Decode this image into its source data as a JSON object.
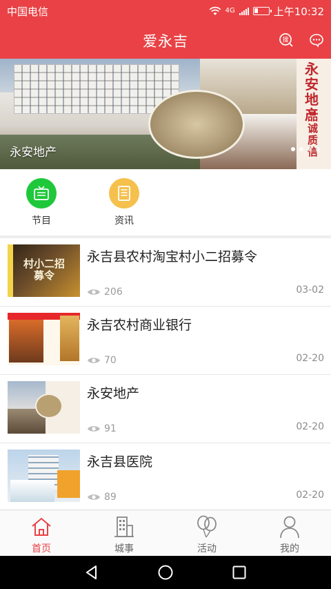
{
  "status_bar": {
    "carrier": "中国电信",
    "network": "4G",
    "time": "上午10:32"
  },
  "header": {
    "title": "爱永吉",
    "search_icon": "search-icon",
    "message_icon": "message-icon"
  },
  "banner": {
    "caption": "永安地产",
    "sign_text_1": "永安地产",
    "sign_text_2": "品诚质信",
    "dots": 4,
    "active_dot": 0
  },
  "quick_nav": [
    {
      "label": "节目",
      "icon": "tv-icon",
      "color": "#1fc83a"
    },
    {
      "label": "资讯",
      "icon": "news-icon",
      "color": "#f5c04c"
    }
  ],
  "news": [
    {
      "title": "永吉县农村淘宝村小二招募令",
      "views": "206",
      "date": "03-02",
      "thumb_text": "村小二招募令"
    },
    {
      "title": "永吉农村商业银行",
      "views": "70",
      "date": "02-20"
    },
    {
      "title": "永安地产",
      "views": "91",
      "date": "02-20"
    },
    {
      "title": "永吉县医院",
      "views": "89",
      "date": "02-20"
    }
  ],
  "tabbar": [
    {
      "label": "首页",
      "icon": "home-icon",
      "active": true
    },
    {
      "label": "城事",
      "icon": "building-icon",
      "active": false
    },
    {
      "label": "活动",
      "icon": "balloon-icon",
      "active": false
    },
    {
      "label": "我的",
      "icon": "person-icon",
      "active": false
    }
  ],
  "colors": {
    "brand_red": "#e94145",
    "green": "#1fc83a",
    "yellow": "#f5c04c"
  }
}
